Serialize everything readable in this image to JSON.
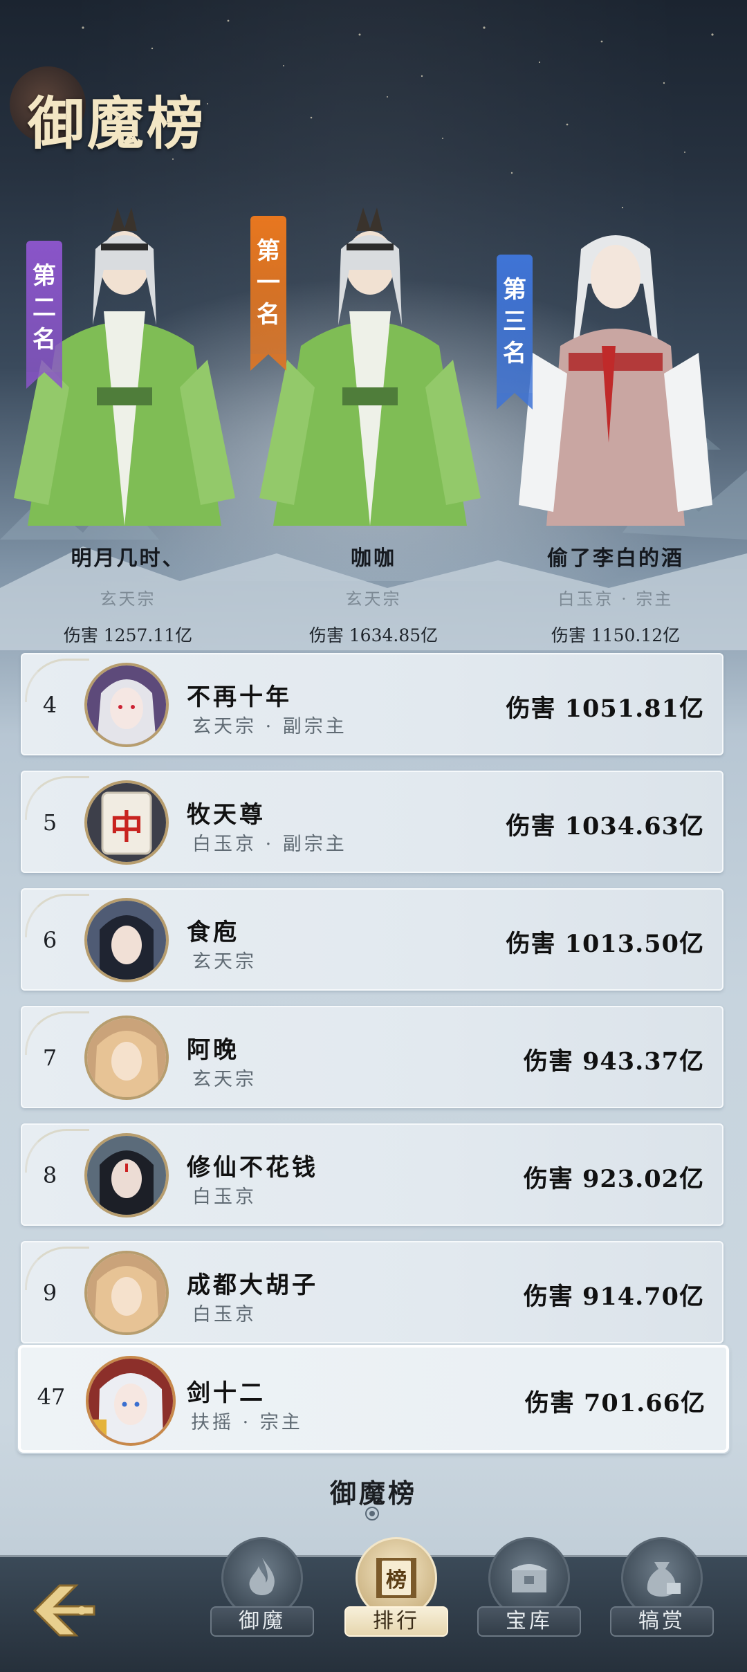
{
  "page": {
    "title": "御魔榜"
  },
  "top3": [
    {
      "rank_label": "第二名",
      "rank_chars": [
        "第",
        "二",
        "名"
      ],
      "name": "明月几时、",
      "guild": "玄天宗",
      "damage": "伤害 1257.11亿",
      "banner_color": "#8a55c9"
    },
    {
      "rank_label": "第一名",
      "rank_chars": [
        "第",
        "一",
        "名"
      ],
      "name": "咖咖",
      "guild": "玄天宗",
      "damage": "伤害 1634.85亿",
      "banner_color": "#e8771f"
    },
    {
      "rank_label": "第三名",
      "rank_chars": [
        "第",
        "三",
        "名"
      ],
      "name": "偷了李白的酒",
      "guild": "白玉京 · 宗主",
      "damage": "伤害 1150.12亿",
      "banner_color": "#3f74d6"
    }
  ],
  "ranking": [
    {
      "rank": "4",
      "name": "不再十年",
      "guild": "玄天宗 · 副宗主",
      "damage": "伤害 1051.81亿",
      "avatar": "silver-hair-avatar"
    },
    {
      "rank": "5",
      "name": "牧天尊",
      "guild": "白玉京 · 副宗主",
      "damage": "伤害 1034.63亿",
      "avatar": "mahjong-tile-avatar",
      "tile_char": "中"
    },
    {
      "rank": "6",
      "name": "食庖",
      "guild": "玄天宗",
      "damage": "伤害 1013.50亿",
      "avatar": "dark-hair-avatar"
    },
    {
      "rank": "7",
      "name": "阿晚",
      "guild": "玄天宗",
      "damage": "伤害 943.37亿",
      "avatar": "blonde-hair-avatar"
    },
    {
      "rank": "8",
      "name": "修仙不花钱",
      "guild": "白玉京",
      "damage": "伤害 923.02亿",
      "avatar": "dark-hair-avatar"
    },
    {
      "rank": "9",
      "name": "成都大胡子",
      "guild": "白玉京",
      "damage": "伤害 914.70亿",
      "avatar": "blonde-hair-avatar"
    }
  ],
  "self_row": {
    "rank": "47",
    "name": "剑十二",
    "guild": "扶摇 · 宗主",
    "damage": "伤害 701.66亿",
    "avatar": "white-hair-avatar"
  },
  "footer": {
    "label": "御魔榜"
  },
  "nav": {
    "back_icon": "back-arrow-icon",
    "items": [
      {
        "label": "御魔",
        "icon": "flame-icon",
        "active": false
      },
      {
        "label": "排行",
        "icon": "ranking-scroll-icon",
        "active": true,
        "icon_char": "榜"
      },
      {
        "label": "宝库",
        "icon": "treasure-chest-icon",
        "active": false
      },
      {
        "label": "犒赏",
        "icon": "money-bag-icon",
        "active": false
      }
    ]
  }
}
